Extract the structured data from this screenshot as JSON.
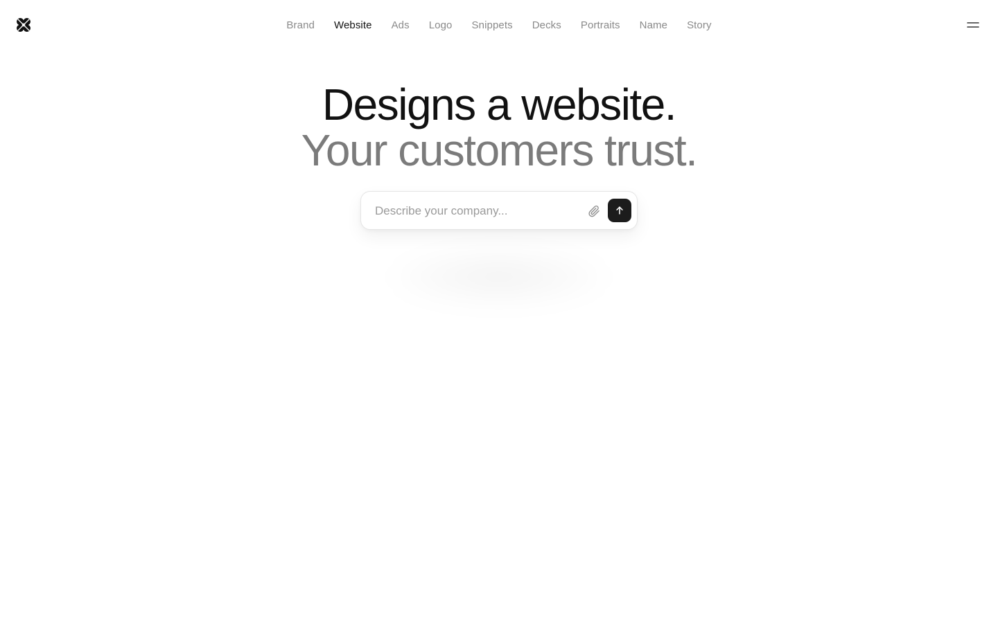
{
  "header": {
    "logo_icon": "clover-logo-icon",
    "nav": [
      {
        "label": "Brand",
        "active": false
      },
      {
        "label": "Website",
        "active": true
      },
      {
        "label": "Ads",
        "active": false
      },
      {
        "label": "Logo",
        "active": false
      },
      {
        "label": "Snippets",
        "active": false
      },
      {
        "label": "Decks",
        "active": false
      },
      {
        "label": "Portraits",
        "active": false
      },
      {
        "label": "Name",
        "active": false
      },
      {
        "label": "Story",
        "active": false
      }
    ],
    "menu_icon": "hamburger-menu-icon"
  },
  "hero": {
    "headline": "Designs a website.",
    "subheadline": "Your customers trust."
  },
  "prompt": {
    "placeholder": "Describe your company...",
    "value": "",
    "attach_icon": "paperclip-icon",
    "send_icon": "arrow-up-icon"
  },
  "colors": {
    "text_primary": "#111111",
    "text_secondary": "#7b7b7b",
    "nav_inactive": "#8a8a8a",
    "send_button": "#1c1c1c",
    "background": "#ffffff"
  }
}
